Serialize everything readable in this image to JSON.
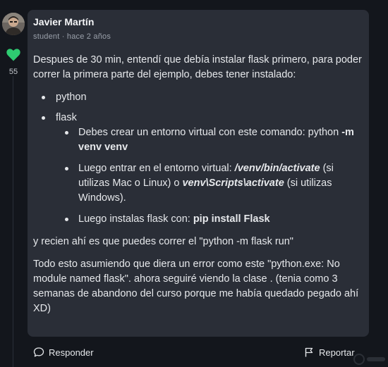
{
  "comment": {
    "author": "Javier Martín",
    "role": "student",
    "separator": "·",
    "time": "hace 2 años",
    "likes": "55",
    "intro": "Despues de 30 min, entendí que debía instalar flask primero, para poder correr la primera parte del ejemplo, debes tener instalado:",
    "list": {
      "item1": "python",
      "item2": "flask",
      "sub1": {
        "text": "Debes crear un entorno virtual con este comando: python ",
        "bold": "-m venv venv"
      },
      "sub2": {
        "text1": "Luego entrar en el entorno virtual: ",
        "bolditalic1": "/venv/bin/activate",
        "text2": " (si utilizas Mac o Linux) o ",
        "bolditalic2": "venv\\Scripts\\activate",
        "text3": " (si utilizas Windows)."
      },
      "sub3": {
        "text": "Luego instalas flask con: ",
        "bold": "pip install Flask"
      }
    },
    "para2": "y recien ahí es que puedes correr el \"python -m flask run\"",
    "para3": "Todo esto asumiendo que diera un error como este \"python.exe: No module named flask\". ahora seguiré viendo la clase . (tenia como 3 semanas de abandono del curso porque me había quedado pegado ahí XD)"
  },
  "actions": {
    "reply": "Responder",
    "report": "Reportar"
  },
  "icons": {
    "heart": "heart-icon",
    "reply": "speech-bubble-icon",
    "report": "flag-icon"
  },
  "colors": {
    "background": "#13161c",
    "card": "#2a2e37",
    "heart": "#2ecc71",
    "text": "#e6e8eb",
    "muted": "#9aa0aa"
  }
}
